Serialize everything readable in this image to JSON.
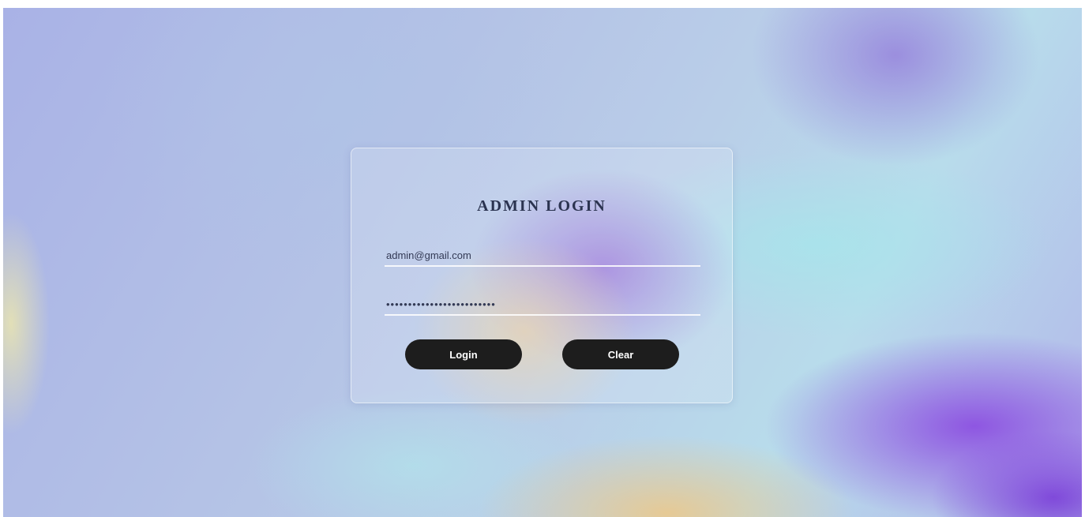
{
  "login_form": {
    "title": "ADMIN LOGIN",
    "email_value": "admin@gmail.com",
    "password_value": "•••••••••••••••••••••••••",
    "login_label": "Login",
    "clear_label": "Clear"
  }
}
